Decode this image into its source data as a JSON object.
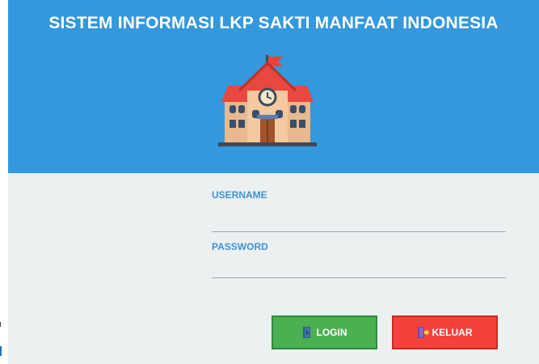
{
  "header": {
    "title": "SISTEM INFORMASI LKP SAKTI MANFAAT INDONESIA",
    "logo_icon": "school-building-icon"
  },
  "form": {
    "username_label": "USERNAME",
    "username_value": "",
    "password_label": "PASSWORD",
    "password_value": ""
  },
  "buttons": {
    "login_label": "LOGIN",
    "login_icon": "login-door-icon",
    "keluar_label": "KELUAR",
    "keluar_icon": "exit-door-icon"
  },
  "colors": {
    "header_bg": "#3398dc",
    "panel_bg": "#ecf0f1",
    "label_text": "#3e93d6",
    "login_button": "#4caf50",
    "keluar_button": "#f3423c"
  }
}
